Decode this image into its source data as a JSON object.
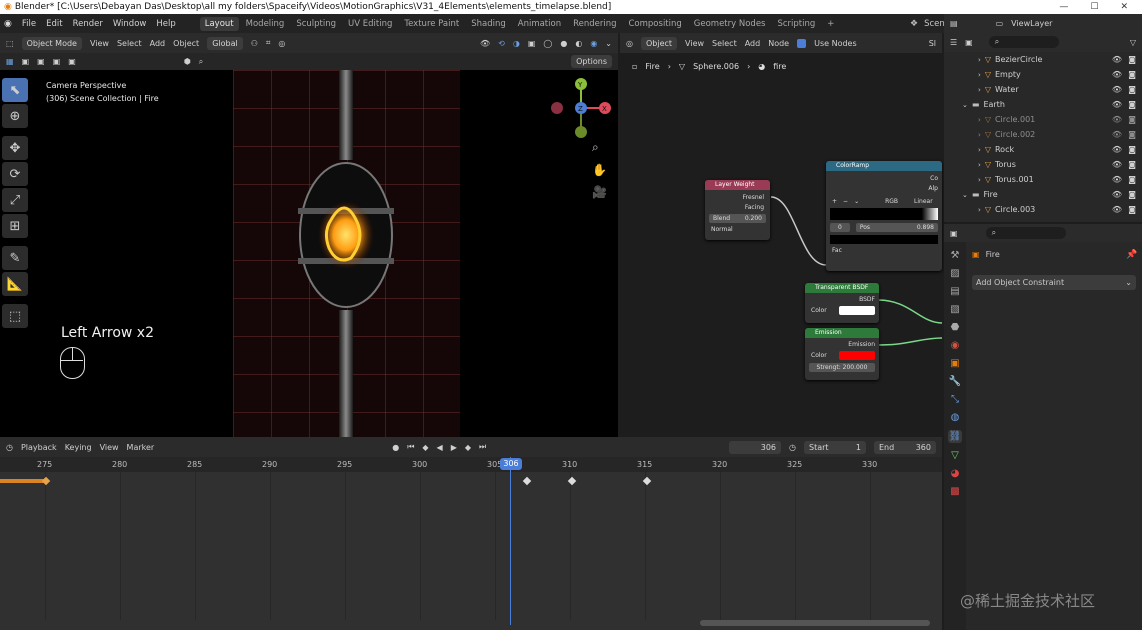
{
  "window": {
    "title": "Blender* [C:\\Users\\Debayan Das\\Desktop\\all my folders\\Spaceify\\Videos\\MotionGraphics\\V31_4Elements\\elements_timelapse.blend]"
  },
  "topbar": {
    "menus": [
      "File",
      "Edit",
      "Render",
      "Window",
      "Help"
    ],
    "workspaces": [
      "Layout",
      "Modeling",
      "Sculpting",
      "UV Editing",
      "Texture Paint",
      "Shading",
      "Animation",
      "Rendering",
      "Compositing",
      "Geometry Nodes",
      "Scripting"
    ],
    "active_workspace": "Layout",
    "scene": "Scene",
    "view_layer": "ViewLayer"
  },
  "viewport": {
    "header": {
      "mode": "Object Mode",
      "menus": [
        "View",
        "Select",
        "Add",
        "Object"
      ],
      "orientation": "Global",
      "options": "Options"
    },
    "overlay_title": "Camera Perspective",
    "overlay_collection": "(306) Scene Collection | Fire",
    "keyhint": "Left Arrow x2",
    "gizmo": {
      "z": "Z",
      "y": "Y",
      "x": "X"
    }
  },
  "node_editor": {
    "header": {
      "type": "Object",
      "menus": [
        "View",
        "Select",
        "Add",
        "Node"
      ],
      "use_nodes": "Use Nodes",
      "slot": "Sl"
    },
    "breadcrumb": [
      "Fire",
      "Sphere.006",
      "fire"
    ],
    "nodes": {
      "layer_weight": {
        "title": "Layer Weight",
        "out1": "Fresnel",
        "out2": "Facing",
        "blend_label": "Blend",
        "blend_value": "0.200",
        "normal": "Normal"
      },
      "color_ramp": {
        "title": "ColorRamp",
        "out1": "Co",
        "out2": "Alp",
        "mode": "RGB",
        "interp": "Linear",
        "pos_index": "0",
        "pos_label": "Pos",
        "pos_value": "0.898",
        "fac": "Fac"
      },
      "transparent": {
        "title": "Transparent BSDF",
        "out": "BSDF",
        "color": "Color",
        "color_value": "#ffffff"
      },
      "emission": {
        "title": "Emission",
        "out": "Emission",
        "color": "Color",
        "color_value": "#ff0000",
        "strength": "Strengt: 200.000"
      }
    }
  },
  "outliner": {
    "rows": [
      {
        "name": "BezierCircle",
        "indent": 1,
        "color": "#e8a24a",
        "icon": "curve-icon"
      },
      {
        "name": "Empty",
        "indent": 1,
        "color": "#e8a24a",
        "icon": "empty-icon"
      },
      {
        "name": "Water",
        "indent": 1,
        "color": "#e8a24a",
        "icon": "mesh-icon"
      },
      {
        "name": "Earth",
        "indent": 0,
        "color": "#bdbdbd",
        "icon": "collection-icon"
      },
      {
        "name": "Circle.001",
        "indent": 1,
        "color": "#e8a24a",
        "icon": "mesh-icon",
        "dim": true
      },
      {
        "name": "Circle.002",
        "indent": 1,
        "color": "#e8a24a",
        "icon": "mesh-icon",
        "dim": true
      },
      {
        "name": "Rock",
        "indent": 1,
        "color": "#e8a24a",
        "icon": "mesh-icon"
      },
      {
        "name": "Torus",
        "indent": 1,
        "color": "#e8a24a",
        "icon": "mesh-icon"
      },
      {
        "name": "Torus.001",
        "indent": 1,
        "color": "#e8a24a",
        "icon": "mesh-icon"
      },
      {
        "name": "Fire",
        "indent": 0,
        "color": "#bdbdbd",
        "icon": "collection-icon"
      },
      {
        "name": "Circle.003",
        "indent": 1,
        "color": "#e8a24a",
        "icon": "mesh-icon"
      }
    ]
  },
  "properties": {
    "object_name": "Fire",
    "add_constraint": "Add Object Constraint"
  },
  "timeline": {
    "menus": [
      "Playback",
      "Keying",
      "View",
      "Marker"
    ],
    "current_frame": "306",
    "start_label": "Start",
    "start": "1",
    "end_label": "End",
    "end": "360",
    "ticks": [
      "275",
      "280",
      "285",
      "290",
      "295",
      "300",
      "305",
      "310",
      "315",
      "320",
      "325",
      "330"
    ]
  },
  "watermark": "@稀土掘金技术社区"
}
